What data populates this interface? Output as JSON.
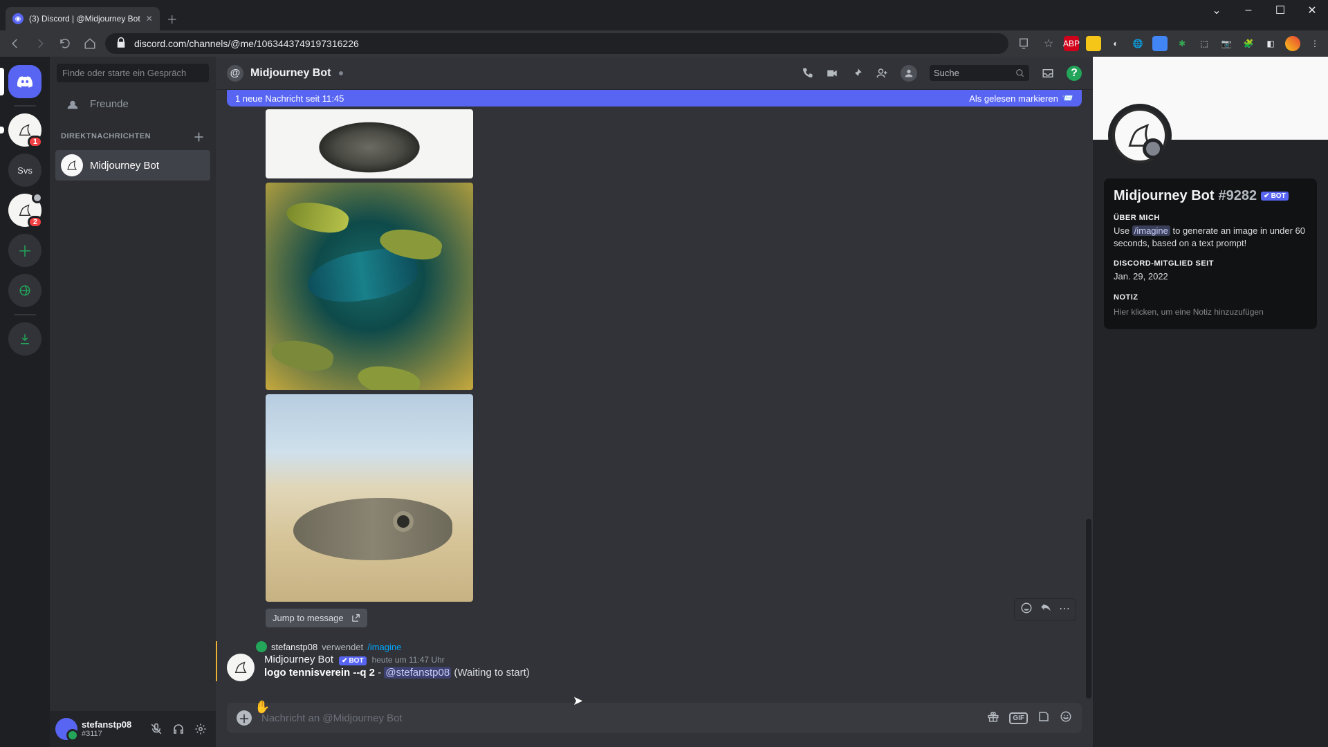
{
  "browser": {
    "tab_title": "(3) Discord | @Midjourney Bot",
    "url": "discord.com/channels/@me/1063443749197316226",
    "win": {
      "min": "–",
      "max": "☐",
      "close": "✕"
    }
  },
  "ext_badges": [
    "ABP",
    "•",
    "",
    "",
    "",
    "",
    "",
    "",
    "",
    "",
    "",
    ""
  ],
  "guilds": {
    "svs_label": "Svs",
    "badge_mj": "1",
    "badge_other": "2"
  },
  "sidebar": {
    "search_placeholder": "Finde oder starte ein Gespräch",
    "friends_label": "Freunde",
    "dm_header": "DIREKTNACHRICHTEN",
    "dm_items": [
      {
        "label": "Midjourney Bot"
      }
    ]
  },
  "user": {
    "name": "stefanstp08",
    "tag": "#3117"
  },
  "header": {
    "title": "Midjourney Bot",
    "search_placeholder": "Suche"
  },
  "new_msg_bar": {
    "left": "1 neue Nachricht seit 11:45",
    "right": "Als gelesen markieren"
  },
  "jump_label": "Jump to message",
  "reply": {
    "user": "stefanstp08",
    "verb": "verwendet",
    "command": "/imagine"
  },
  "message": {
    "author": "Midjourney Bot",
    "bot_tag": "BOT",
    "time": "heute um 11:47 Uhr",
    "prompt_bold": "logo tennisverein --q 2",
    "sep": " - ",
    "mention": "@stefanstp08",
    "status": " (Waiting to start)"
  },
  "input": {
    "placeholder": "Nachricht an @Midjourney Bot"
  },
  "profile": {
    "name": "Midjourney Bot",
    "disc": "#9282",
    "bot_tag": "BOT",
    "about_h": "ÜBER MICH",
    "about_pre": "Use ",
    "about_cmd": "/imagine",
    "about_post": " to generate an image in under 60 seconds, based on a text prompt!",
    "since_h": "DISCORD-MITGLIED SEIT",
    "since_v": "Jan. 29, 2022",
    "note_h": "NOTIZ",
    "note_placeholder": "Hier klicken, um eine Notiz hinzuzufügen"
  }
}
